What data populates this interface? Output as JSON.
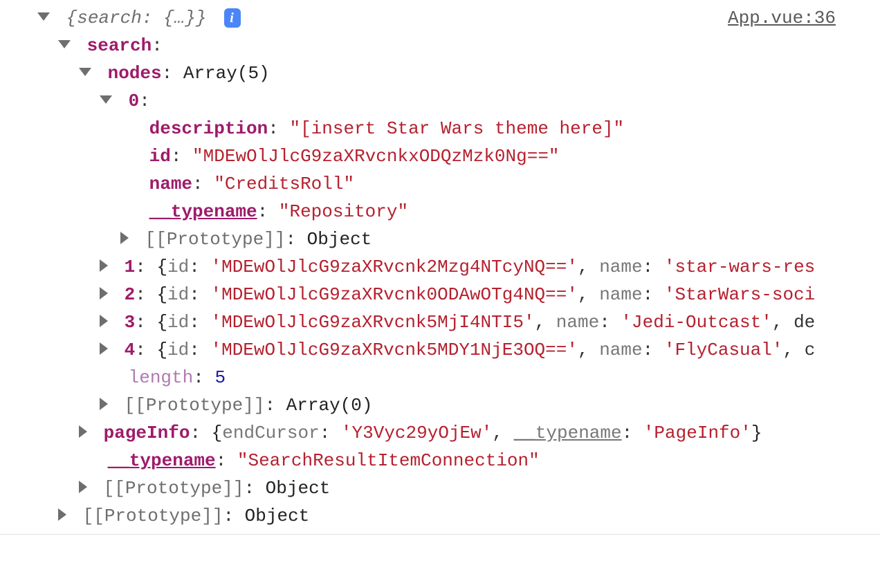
{
  "source": {
    "file": "App.vue",
    "line": 36,
    "display": "App.vue:36"
  },
  "root_preview": "{search: {…}}",
  "info_badge": "i",
  "tree": {
    "search_key": "search",
    "nodes_key": "nodes",
    "nodes_preview": "Array(5)",
    "items": [
      {
        "index": "0",
        "description_key": "description",
        "description_val": "\"[insert Star Wars theme here]\"",
        "id_key": "id",
        "id_val": "\"MDEwOlJlcG9zaXRvcnkxODQzMzk0Ng==\"",
        "name_key": "name",
        "name_val": "\"CreditsRoll\"",
        "typename_key": "__typename",
        "typename_val": "\"Repository\"",
        "proto_label": "[[Prototype]]",
        "proto_val": "Object"
      },
      {
        "index": "1",
        "id_key": "id",
        "id_val": "'MDEwOlJlcG9zaXRvcnk2Mzg4NTcyNQ=='",
        "name_key": "name",
        "name_val": "'star-wars-res",
        "tail": ""
      },
      {
        "index": "2",
        "id_key": "id",
        "id_val": "'MDEwOlJlcG9zaXRvcnk0ODAwOTg4NQ=='",
        "name_key": "name",
        "name_val": "'StarWars-soci",
        "tail": ""
      },
      {
        "index": "3",
        "id_key": "id",
        "id_val": "'MDEwOlJlcG9zaXRvcnk5MjI4NTI5'",
        "name_key": "name",
        "name_val": "'Jedi-Outcast'",
        "tail": ", de"
      },
      {
        "index": "4",
        "id_key": "id",
        "id_val": "'MDEwOlJlcG9zaXRvcnk5MDY1NjE3OQ=='",
        "name_key": "name",
        "name_val": "'FlyCasual'",
        "tail": ", c"
      }
    ],
    "length_key": "length",
    "length_val": "5",
    "array_proto_label": "[[Prototype]]",
    "array_proto_val": "Array(0)",
    "pageInfo": {
      "key": "pageInfo",
      "endCursor_key": "endCursor",
      "endCursor_val": "'Y3Vyc29yOjEw'",
      "typename_key": "__typename",
      "typename_val": "'PageInfo'"
    },
    "search_typename_key": "__typename",
    "search_typename_val": "\"SearchResultItemConnection\"",
    "search_proto_label": "[[Prototype]]",
    "search_proto_val": "Object",
    "root_proto_label": "[[Prototype]]",
    "root_proto_val": "Object"
  }
}
